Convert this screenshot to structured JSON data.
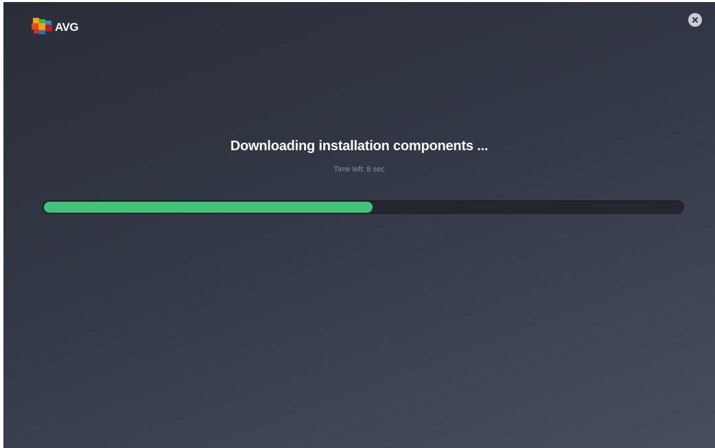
{
  "window": {
    "logo_text": "AVG",
    "close_icon": "close-icon"
  },
  "main": {
    "title": "Downloading installation components ...",
    "time_left": "Time left: 8 sec"
  },
  "progress": {
    "fraction": 0.515
  },
  "colors": {
    "progress_fill": "#43c37a",
    "progress_track": "#23262f",
    "background": "#353a47",
    "title_text": "#ffffff",
    "subtitle_text": "#8a8f9c"
  }
}
